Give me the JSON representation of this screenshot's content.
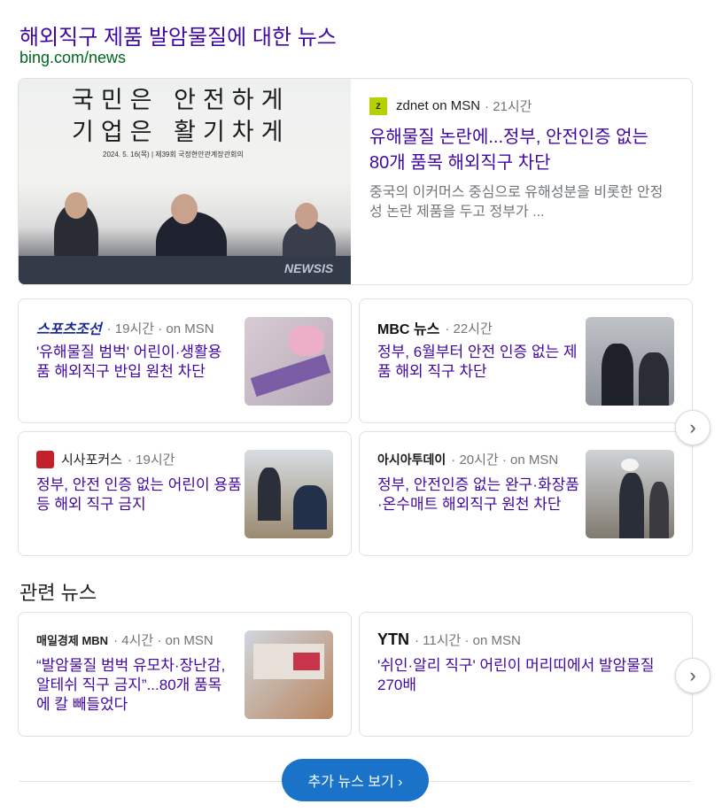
{
  "header": {
    "title": "해외직구 제품 발암물질에 대한 뉴스",
    "url": "bing.com/news"
  },
  "featured": {
    "image": {
      "line1": "국민은 안전하게",
      "line2": "기업은 활기차게",
      "caption": "2024. 5. 16(목) | 제39회 국정현안관계장관회의",
      "watermark": "NEWSIS"
    },
    "source": "zdnet on MSN",
    "time": "· 21시간",
    "headline": "유해물질 논란에...정부, 안전인증 없는 80개 품목 해외직구 차단",
    "snippet": "중국의 이커머스 중심으로 유해성분을 비롯한 안정성 논란 제품을 두고 정부가 ..."
  },
  "cards": [
    {
      "logo": "스포츠조선",
      "meta": "· 19시간 · on MSN",
      "headline": "'유해물질 범벅' 어린이·생활용품 해외직구 반입 원천 차단"
    },
    {
      "logo": "MBC 뉴스",
      "meta": "· 22시간",
      "headline": "정부, 6월부터 안전 인증 없는 제품 해외 직구 차단"
    },
    {
      "logo": "시사포커스",
      "meta": "· 19시간",
      "headline": "정부, 안전 인증 없는 어린이 용품 등 해외 직구 금지"
    },
    {
      "logo": "아시아투데이",
      "meta": "· 20시간 · on MSN",
      "headline": "정부, 안전인증 없는 완구·화장품·온수매트 해외직구 원천 차단"
    }
  ],
  "related": {
    "title": "관련 뉴스",
    "cards": [
      {
        "logo": "매일경제 MBN",
        "meta": "· 4시간 · on MSN",
        "headline": "“발암물질 범벅 유모차·장난감, 알테쉬 직구 금지”...80개 품목에 칼 빼들었다"
      },
      {
        "logo": "YTN",
        "meta": "· 11시간 · on MSN",
        "headline": "'쉬인·알리 직구' 어린이 머리띠에서 발암물질 270배"
      }
    ]
  },
  "more_button": "추가 뉴스 보기 ›",
  "icons": {
    "next": "chevron-right-icon"
  },
  "colors": {
    "headline": "#4007a2",
    "url": "#006621",
    "button": "#1a73c8"
  }
}
